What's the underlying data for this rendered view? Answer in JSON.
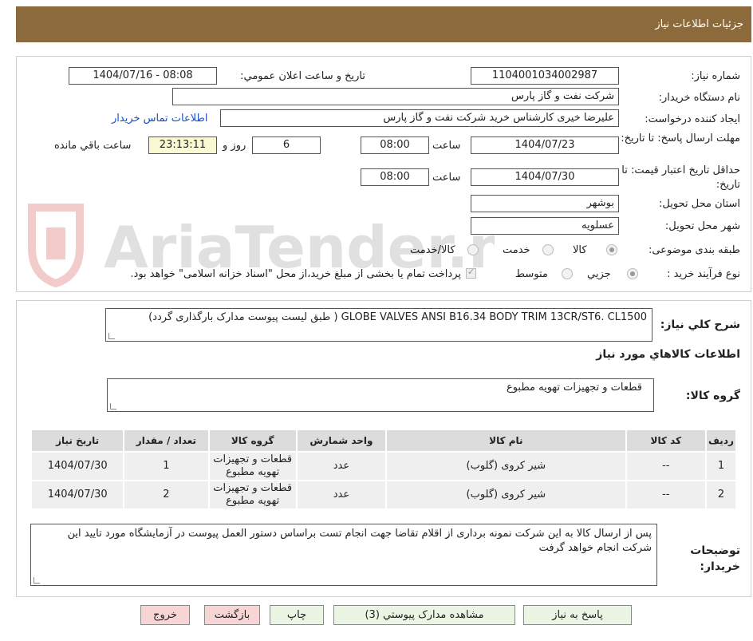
{
  "header": {
    "title": "جزئیات اطلاعات نیاز"
  },
  "fields": {
    "need_number_label": "شماره نیاز:",
    "need_number": "1104001034002987",
    "announce_label": "تاریخ و ساعت اعلان عمومي:",
    "announce_value": "1404/07/16 - 08:08",
    "buyer_org_label": "نام دستگاه خریدار:",
    "buyer_org": "شرکت نفت و گاز پارس",
    "creator_label": "ایجاد کننده درخواست:",
    "creator": "علیرضا  خیری کارشناس خرید  شرکت نفت و گاز پارس",
    "contact_link": "اطلاعات تماس خریدار",
    "deadline_label": "مهلت ارسال پاسخ: تا تاریخ:",
    "deadline_date": "1404/07/23",
    "time_label": "ساعت",
    "deadline_time": "08:00",
    "days": "6",
    "days_label": "روز و",
    "remaining": "23:13:11",
    "remaining_label": "ساعت باقي مانده",
    "price_validity_label": "حداقل تاریخ اعتبار قیمت: تا تاریخ:",
    "price_validity_date": "1404/07/30",
    "price_validity_time": "08:00",
    "province_label": "استان محل تحویل:",
    "province": "بوشهر",
    "city_label": "شهر محل تحویل:",
    "city": "عسلویه",
    "category_label": "طبقه بندی موضوعی:",
    "category_options": [
      "کالا",
      "خدمت",
      "کالا/خدمت"
    ],
    "process_label": "نوع فرآیند خرید :",
    "process_options": [
      "جزیي",
      "متوسط"
    ],
    "payment_note": "پرداخت تمام یا بخشی از مبلغ خرید،از محل \"اسناد خزانه اسلامی\" خواهد بود."
  },
  "watermark": "AriaTender.neT",
  "summary": {
    "label": "شرح کلي نیاز:",
    "text": "GLOBE VALVES ANSI B16.34  BODY TRIM 13CR/ST6. CL1500 ( طبق لیست پیوست مدارک بارگذاری گردد)",
    "goods_info_title": "اطلاعات کالاهاي مورد نیاز",
    "group_label": "گروه کالا:",
    "group_value": "قطعات و تجهیزات تهویه مطبوع"
  },
  "table": {
    "headers": [
      "ردیف",
      "کد کالا",
      "نام کالا",
      "واحد شمارش",
      "گروه کالا",
      "تعداد / مقدار",
      "تاریخ نیاز"
    ],
    "rows": [
      [
        "1",
        "--",
        "شیر کروی (گلوب)",
        "عدد",
        "قطعات و تجهیزات تهویه مطبوع",
        "1",
        "1404/07/30"
      ],
      [
        "2",
        "--",
        "شیر کروی (گلوب)",
        "عدد",
        "قطعات و تجهیزات تهویه مطبوع",
        "2",
        "1404/07/30"
      ]
    ]
  },
  "notes": {
    "label": "توضیحات خریدار:",
    "text": "پس از ارسال کالا به این شرکت نمونه برداری از اقلام تقاضا جهت انجام تست  براساس دستور العمل پیوست  در آزمایشگاه مورد تایید این شرکت انجام خواهد گرفت"
  },
  "buttons": {
    "reply": "پاسخ به نیاز",
    "attachments": "مشاهده مدارک پیوستي (3)",
    "print": "چاپ",
    "back": "بازگشت",
    "exit": "خروج"
  }
}
